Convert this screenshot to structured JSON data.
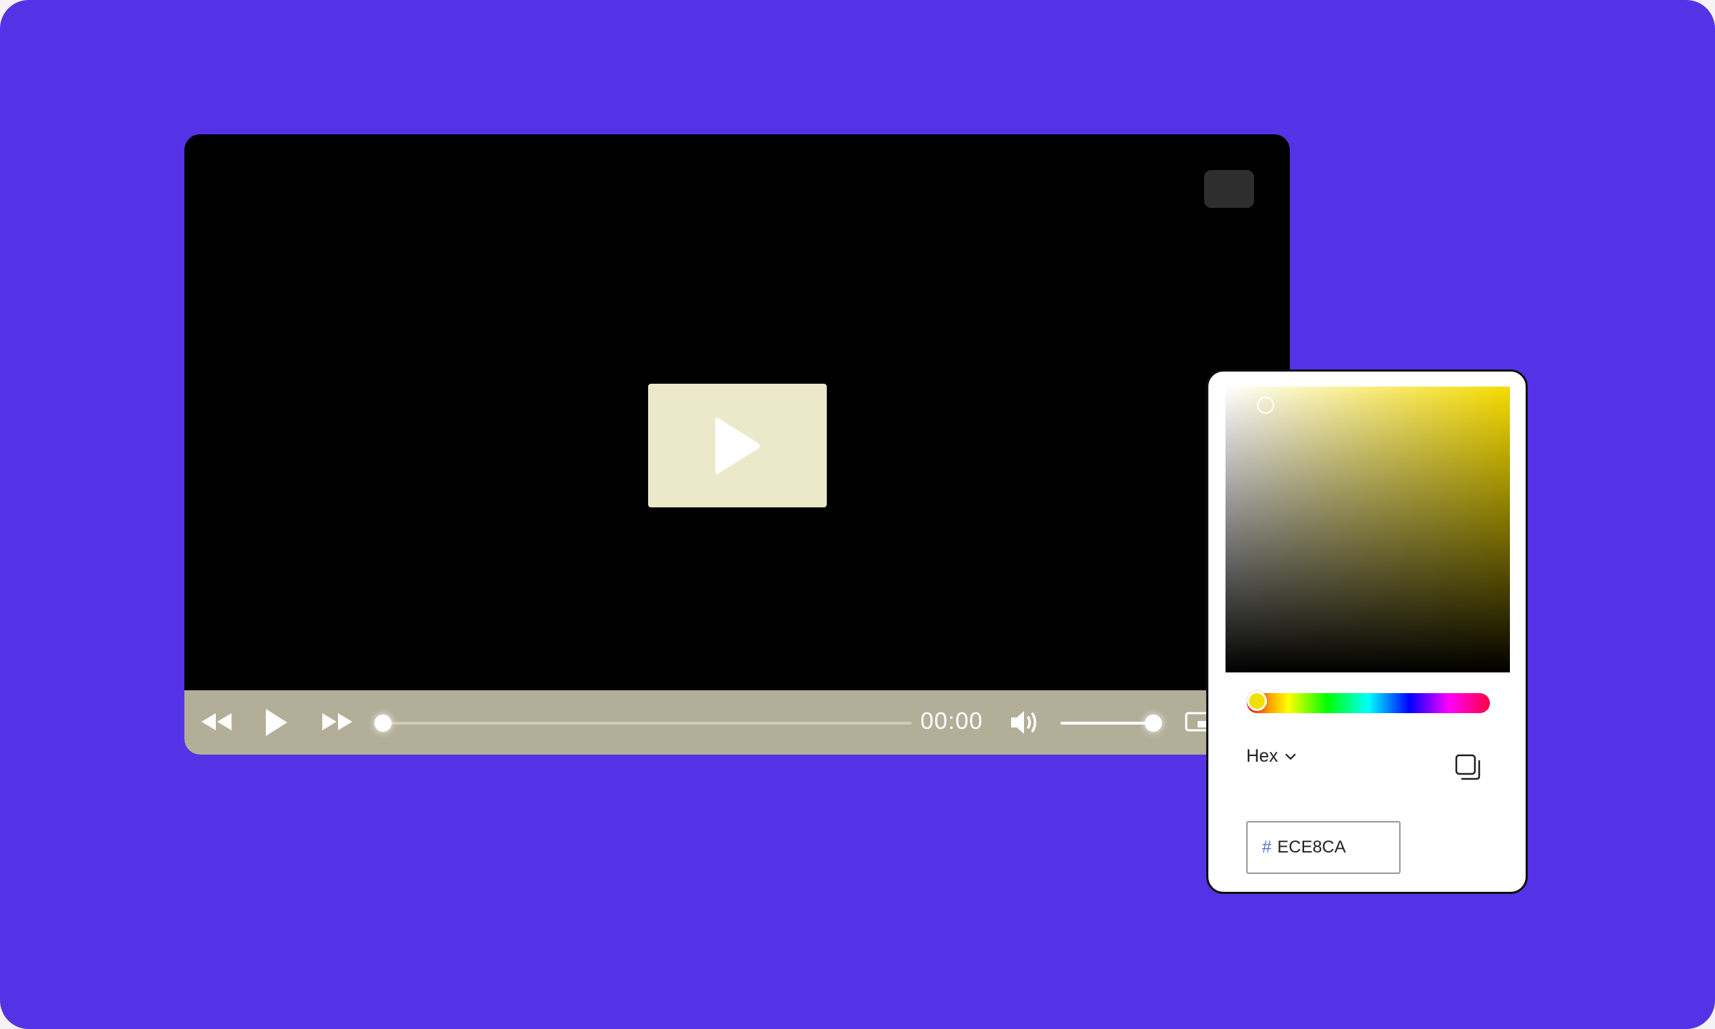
{
  "player": {
    "time": "00:00",
    "progress": 0,
    "volume": 1.0,
    "poster_color": "#ECE8CA",
    "controls_color": "#B3AE98"
  },
  "icons": {
    "rewind": "rewind-icon",
    "play": "play-icon",
    "forward": "fast-forward-icon",
    "volume": "volume-icon",
    "pip": "picture-in-picture-icon",
    "copy": "copy-icon",
    "chevron": "chevron-down-icon"
  },
  "color_picker": {
    "format_label": "Hex",
    "hash": "#",
    "hex_value": "ECE8CA",
    "hue_color": "#F5DB00"
  },
  "colors": {
    "background": "#5433E6"
  }
}
